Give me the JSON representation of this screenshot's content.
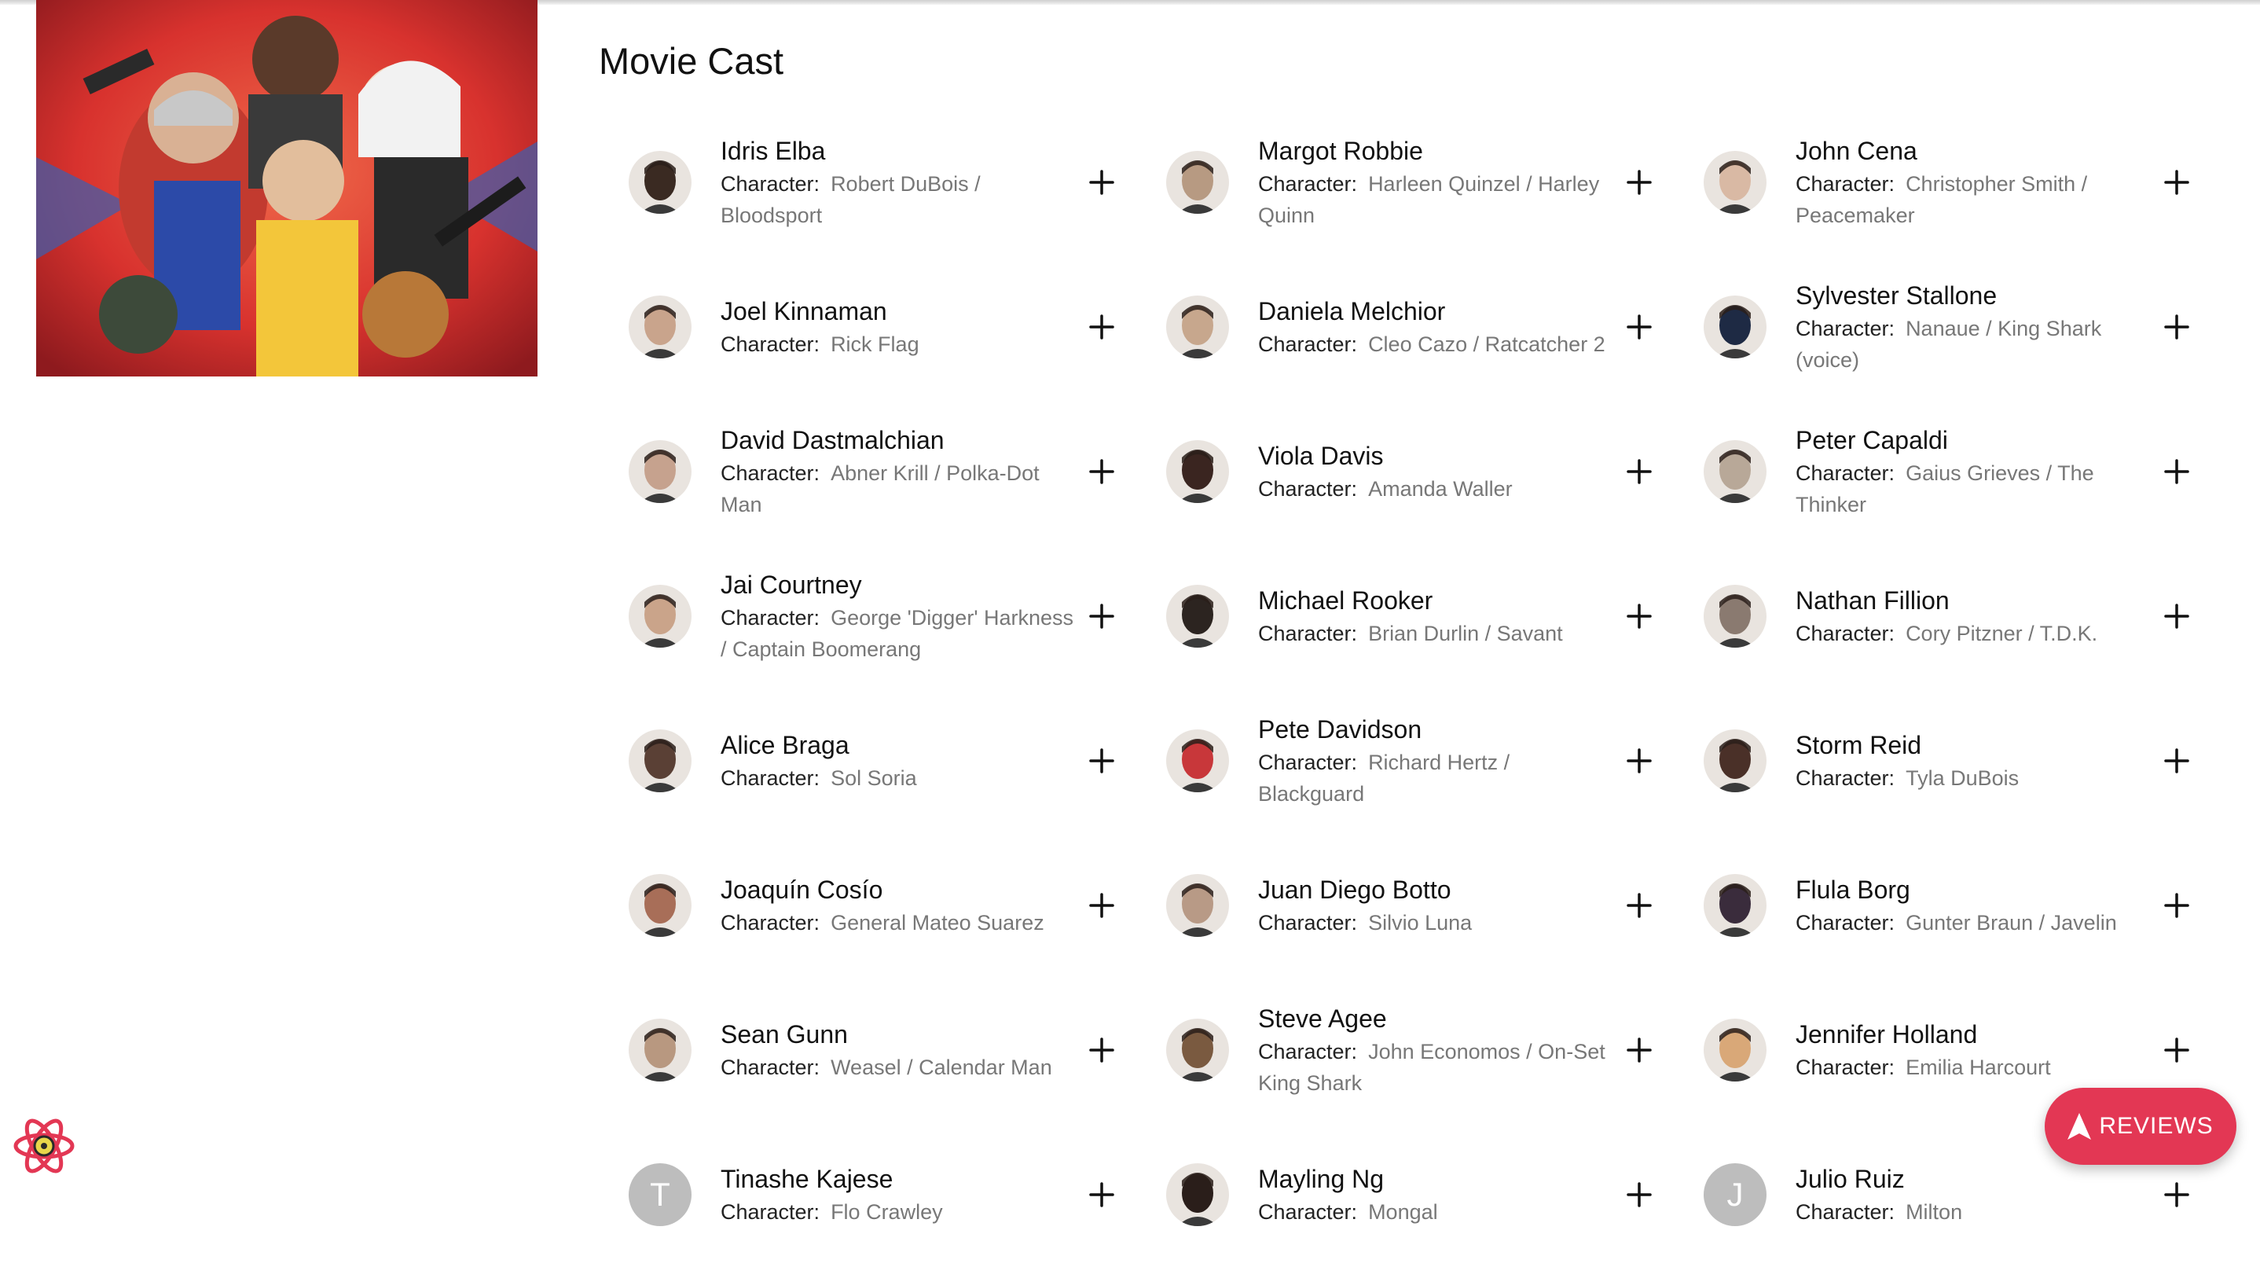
{
  "section_title": "Movie Cast",
  "character_label": "Character:",
  "reviews_button": {
    "label": "REVIEWS",
    "color": "#e33754"
  },
  "cast": [
    [
      {
        "name": "Idris Elba",
        "character": "Robert DuBois / Bloodsport",
        "avatar": "photo",
        "tone": "#3a2a22"
      },
      {
        "name": "Margot Robbie",
        "character": "Harleen Quinzel / Harley Quinn",
        "avatar": "photo",
        "tone": "#b79a82"
      },
      {
        "name": "John Cena",
        "character": "Christopher Smith / Peacemaker",
        "avatar": "photo",
        "tone": "#d9b9a4"
      }
    ],
    [
      {
        "name": "Joel Kinnaman",
        "character": "Rick Flag",
        "avatar": "photo",
        "tone": "#c9a48c"
      },
      {
        "name": "Daniela Melchior",
        "character": "Cleo Cazo / Ratcatcher 2",
        "avatar": "photo",
        "tone": "#c7a78d"
      },
      {
        "name": "Sylvester Stallone",
        "character": "Nanaue / King Shark (voice)",
        "avatar": "photo",
        "tone": "#1e2a44"
      }
    ],
    [
      {
        "name": "David Dastmalchian",
        "character": "Abner Krill / Polka-Dot Man",
        "avatar": "photo",
        "tone": "#c6a28e"
      },
      {
        "name": "Viola Davis",
        "character": "Amanda Waller",
        "avatar": "photo",
        "tone": "#3a2520"
      },
      {
        "name": "Peter Capaldi",
        "character": "Gaius Grieves / The Thinker",
        "avatar": "photo",
        "tone": "#b8a898"
      }
    ],
    [
      {
        "name": "Jai Courtney",
        "character": "George 'Digger' Harkness / Captain Boomerang",
        "avatar": "photo",
        "tone": "#caa48a"
      },
      {
        "name": "Michael Rooker",
        "character": "Brian Durlin / Savant",
        "avatar": "photo",
        "tone": "#2c2420"
      },
      {
        "name": "Nathan Fillion",
        "character": "Cory Pitzner / T.D.K.",
        "avatar": "photo",
        "tone": "#8a7a70"
      }
    ],
    [
      {
        "name": "Alice Braga",
        "character": "Sol Soria",
        "avatar": "photo",
        "tone": "#5a4035"
      },
      {
        "name": "Pete Davidson",
        "character": "Richard Hertz / Blackguard",
        "avatar": "photo",
        "tone": "#c8373a"
      },
      {
        "name": "Storm Reid",
        "character": "Tyla DuBois",
        "avatar": "photo",
        "tone": "#4a3028"
      }
    ],
    [
      {
        "name": "Joaquín Cosío",
        "character": "General Mateo Suarez",
        "avatar": "photo",
        "tone": "#a86e58"
      },
      {
        "name": "Juan Diego Botto",
        "character": "Silvio Luna",
        "avatar": "photo",
        "tone": "#b89a86"
      },
      {
        "name": "Flula Borg",
        "character": "Gunter Braun / Javelin",
        "avatar": "photo",
        "tone": "#3a2c3c"
      }
    ],
    [
      {
        "name": "Sean Gunn",
        "character": "Weasel / Calendar Man",
        "avatar": "photo",
        "tone": "#b89880"
      },
      {
        "name": "Steve Agee",
        "character": "John Economos / On-Set King Shark",
        "avatar": "photo",
        "tone": "#7a5a40"
      },
      {
        "name": "Jennifer Holland",
        "character": "Emilia Harcourt",
        "avatar": "photo",
        "tone": "#d9a878"
      }
    ],
    [
      {
        "name": "Tinashe Kajese",
        "character": "Flo Crawley",
        "avatar": "letter",
        "letter": "T"
      },
      {
        "name": "Mayling Ng",
        "character": "Mongal",
        "avatar": "photo",
        "tone": "#2a1e1a"
      },
      {
        "name": "Julio Ruiz",
        "character": "Milton",
        "avatar": "letter",
        "letter": "J"
      }
    ]
  ]
}
